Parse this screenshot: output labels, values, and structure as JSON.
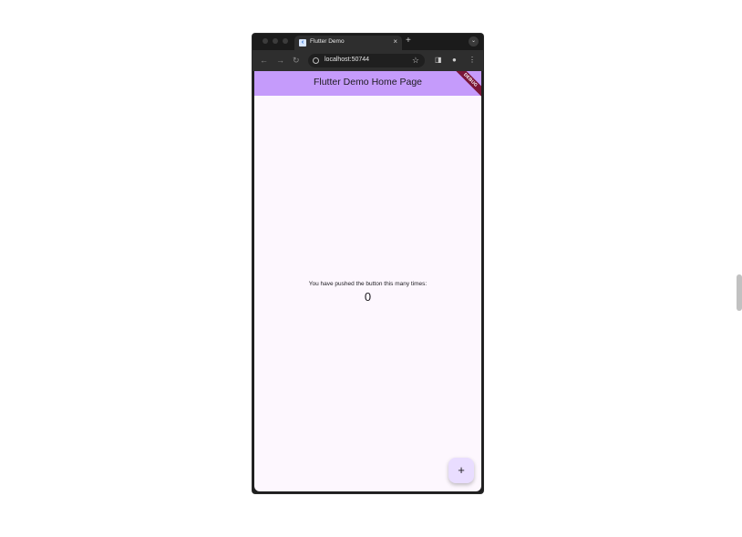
{
  "browser": {
    "tab": {
      "title": "Flutter Demo",
      "favicon": "flutter-icon",
      "close": "×"
    },
    "new_tab": "+",
    "tab_list": "⌄",
    "nav": {
      "back": "←",
      "forward": "→",
      "reload": "↻"
    },
    "address_bar": {
      "url": "localhost:50744",
      "site_info": "info-icon",
      "bookmark": "☆"
    },
    "side_panel": "◨",
    "profile": "●",
    "menu": "⋮"
  },
  "app": {
    "appbar_title": "Flutter Demo Home Page",
    "appbar_color": "#c59bfb",
    "debug_banner": "DEBUG",
    "message": "You have pushed the button this many times:",
    "counter": "0",
    "fab_label": "+"
  }
}
